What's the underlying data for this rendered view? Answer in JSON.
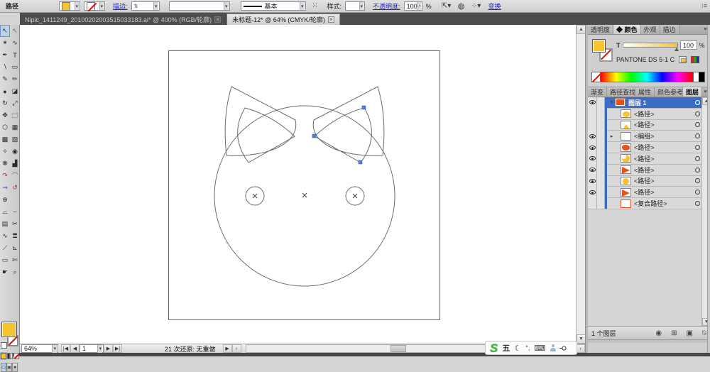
{
  "control_bar": {
    "selection_label": "路径",
    "stroke_link": "描边:",
    "stroke_weight_value": "",
    "brush_value": "基本",
    "style_label": "样式:",
    "opacity_link": "不透明度:",
    "opacity_value": "100",
    "percent_label": "%",
    "transform_link": "变换"
  },
  "document_tabs": [
    {
      "label": "Nipic_1411249_20100202003515033183.ai*  @  400%  (RGB/轮廓)",
      "close": "×",
      "active": false
    },
    {
      "label": "未标题-12*  @  64%  (CMYK/轮廓)",
      "close": "×",
      "active": true
    }
  ],
  "toolbar": {
    "tools": [
      {
        "glyph": "↖",
        "name": "selection-tool",
        "selected": true
      },
      {
        "glyph": "↖",
        "name": "direct-selection-tool",
        "dim": true
      },
      {
        "glyph": "✶",
        "name": "magic-wand-tool"
      },
      {
        "glyph": "∿",
        "name": "lasso-tool"
      },
      {
        "glyph": "✒",
        "name": "pen-tool"
      },
      {
        "glyph": "T",
        "name": "type-tool"
      },
      {
        "glyph": "∖",
        "name": "line-tool"
      },
      {
        "glyph": "▭",
        "name": "rectangle-tool"
      },
      {
        "glyph": "✎",
        "name": "paintbrush-tool"
      },
      {
        "glyph": "✏",
        "name": "pencil-tool"
      },
      {
        "glyph": "●",
        "name": "blob-brush-tool"
      },
      {
        "glyph": "◪",
        "name": "eraser-tool"
      },
      {
        "glyph": "↻",
        "name": "rotate-tool"
      },
      {
        "glyph": "⤢",
        "name": "scale-tool"
      },
      {
        "glyph": "✥",
        "name": "width-tool"
      },
      {
        "glyph": "⬚",
        "name": "free-transform-tool"
      },
      {
        "glyph": "⬡",
        "name": "shape-builder-tool"
      },
      {
        "glyph": "▦",
        "name": "perspective-grid-tool"
      },
      {
        "glyph": "▩",
        "name": "mesh-tool"
      },
      {
        "glyph": "▧",
        "name": "gradient-tool"
      },
      {
        "glyph": "✧",
        "name": "eyedropper-tool"
      },
      {
        "glyph": "◉",
        "name": "blend-tool"
      },
      {
        "glyph": "❋",
        "name": "symbol-sprayer-tool"
      },
      {
        "glyph": "▟",
        "name": "graph-tool"
      },
      {
        "glyph": "↷",
        "name": "artboard-tool",
        "color": "#b3302a"
      },
      {
        "glyph": "⌒",
        "name": "slice-tool",
        "color": "#b3302a"
      },
      {
        "glyph": "⇝",
        "name": "slice-select-tool",
        "color": "#2b4fb3"
      },
      {
        "glyph": "↺",
        "name": "hand-rotate-tool",
        "color": "#b3302a"
      },
      {
        "glyph": "⊕",
        "name": "perspective-selection-tool"
      },
      {
        "glyph": "",
        "name": "spacer"
      },
      {
        "glyph": "⌓",
        "name": "arc-tool"
      },
      {
        "glyph": "⌣",
        "name": "spiral-tool"
      },
      {
        "glyph": "▤",
        "name": "grid-tool"
      },
      {
        "glyph": "✂",
        "name": "scissors-tool"
      },
      {
        "glyph": "∿",
        "name": "warp-tool"
      },
      {
        "glyph": "≣",
        "name": "flare-tool"
      },
      {
        "glyph": "⟋",
        "name": "measure-tool"
      },
      {
        "glyph": "⊾",
        "name": "ruler-tool"
      },
      {
        "glyph": "▭",
        "name": "artboard-tool-2"
      },
      {
        "glyph": "✄",
        "name": "knife-tool"
      },
      {
        "glyph": "☛",
        "name": "hand-tool"
      },
      {
        "glyph": "⌕",
        "name": "zoom-tool"
      }
    ]
  },
  "dock": {
    "group1_tabs": [
      {
        "label": "透明度",
        "active": false
      },
      {
        "label": "◆ 颜色",
        "active": true
      },
      {
        "label": "外观",
        "active": false
      },
      {
        "label": "描边",
        "active": false
      }
    ],
    "color_panel": {
      "tint_label": "T",
      "tint_value": "100",
      "percent_label": "%",
      "swatch_name": "PANTONE DS 5-1 C"
    },
    "group2_tabs": [
      {
        "label": "渐变",
        "active": false
      },
      {
        "label": "路径查找器",
        "active": false
      },
      {
        "label": "属性",
        "active": false
      },
      {
        "label": "颜色参考",
        "active": false
      },
      {
        "label": "图层",
        "active": true
      }
    ],
    "layers": {
      "rows": [
        {
          "name": "图层 1",
          "eye": true,
          "selected": true,
          "expander": "▾",
          "thumb": "th-red-square",
          "target": true,
          "target_selected": true
        },
        {
          "name": "<路径>",
          "eye": false,
          "thumb": "th-yellow-ellipse",
          "target": true
        },
        {
          "name": "<路径>",
          "eye": false,
          "thumb": "th-yellow-tri",
          "target": true
        },
        {
          "name": "<编组>",
          "eye": true,
          "expander": "▸",
          "thumb": "",
          "target": true
        },
        {
          "name": "<路径>",
          "eye": true,
          "thumb": "th-red-blob",
          "target": true
        },
        {
          "name": "<路径>",
          "eye": true,
          "thumb": "th-yellow-pie",
          "target": true,
          "target_selected": true
        },
        {
          "name": "<路径>",
          "eye": true,
          "thumb": "th-red-flag",
          "target": true
        },
        {
          "name": "<路径>",
          "eye": true,
          "thumb": "th-yellow-circle",
          "target": true
        },
        {
          "name": "<路径>",
          "eye": true,
          "thumb": "th-red-flag",
          "target": true
        },
        {
          "name": "<复合路径>",
          "eye": false,
          "thumb": "th-outline",
          "target": true
        }
      ],
      "count_label": "1 个图层"
    }
  },
  "status_bar": {
    "zoom_value": "64%",
    "artboard_value": "1",
    "status_text": "21 次还原: 无重做"
  },
  "ime": {
    "brand": "S",
    "mode_label": "五",
    "moon": "☾",
    "punct": "°,",
    "keyboard": "⌨"
  }
}
